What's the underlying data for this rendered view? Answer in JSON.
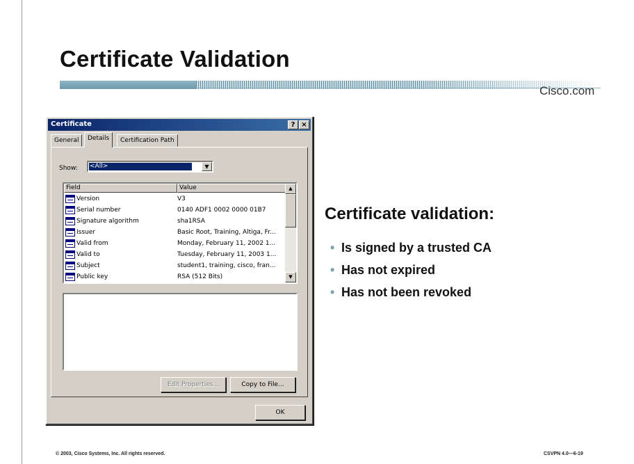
{
  "slide": {
    "title": "Certificate Validation",
    "brand": "Cisco.com",
    "heading": "Certificate validation:",
    "bullets": [
      "Is signed by a trusted CA",
      "Has not expired",
      "Has not been revoked"
    ],
    "footer_left": "© 2003, Cisco Systems, Inc. All rights reserved.",
    "footer_right": "CSVPN 4.0—6-19"
  },
  "dialog": {
    "title": "Certificate",
    "help_label": "?",
    "close_label": "×",
    "tabs": [
      {
        "label": "General",
        "active": false
      },
      {
        "label": "Details",
        "active": true
      },
      {
        "label": "Certification Path",
        "active": false
      }
    ],
    "show_label": "Show:",
    "show_value": "<All>",
    "columns": {
      "field": "Field",
      "value": "Value"
    },
    "rows": [
      {
        "field": "Version",
        "value": "V3"
      },
      {
        "field": "Serial number",
        "value": "0140 ADF1 0002 0000 01B7"
      },
      {
        "field": "Signature algorithm",
        "value": "sha1RSA"
      },
      {
        "field": "Issuer",
        "value": "Basic Root, Training, Altiga, Fr..."
      },
      {
        "field": "Valid from",
        "value": "Monday, February 11, 2002 1..."
      },
      {
        "field": "Valid to",
        "value": "Tuesday, February 11, 2003 1..."
      },
      {
        "field": "Subject",
        "value": "student1, training, cisco, fran..."
      },
      {
        "field": "Public key",
        "value": "RSA (512 Bits)"
      }
    ],
    "edit_button": "Edit Properties...",
    "copy_button": "Copy to File...",
    "ok_button": "OK",
    "icons": {
      "row": "certificate-field-icon",
      "scroll_up": "arrow-up-icon",
      "scroll_down": "arrow-down-icon",
      "dropdown": "chevron-down-icon"
    }
  }
}
